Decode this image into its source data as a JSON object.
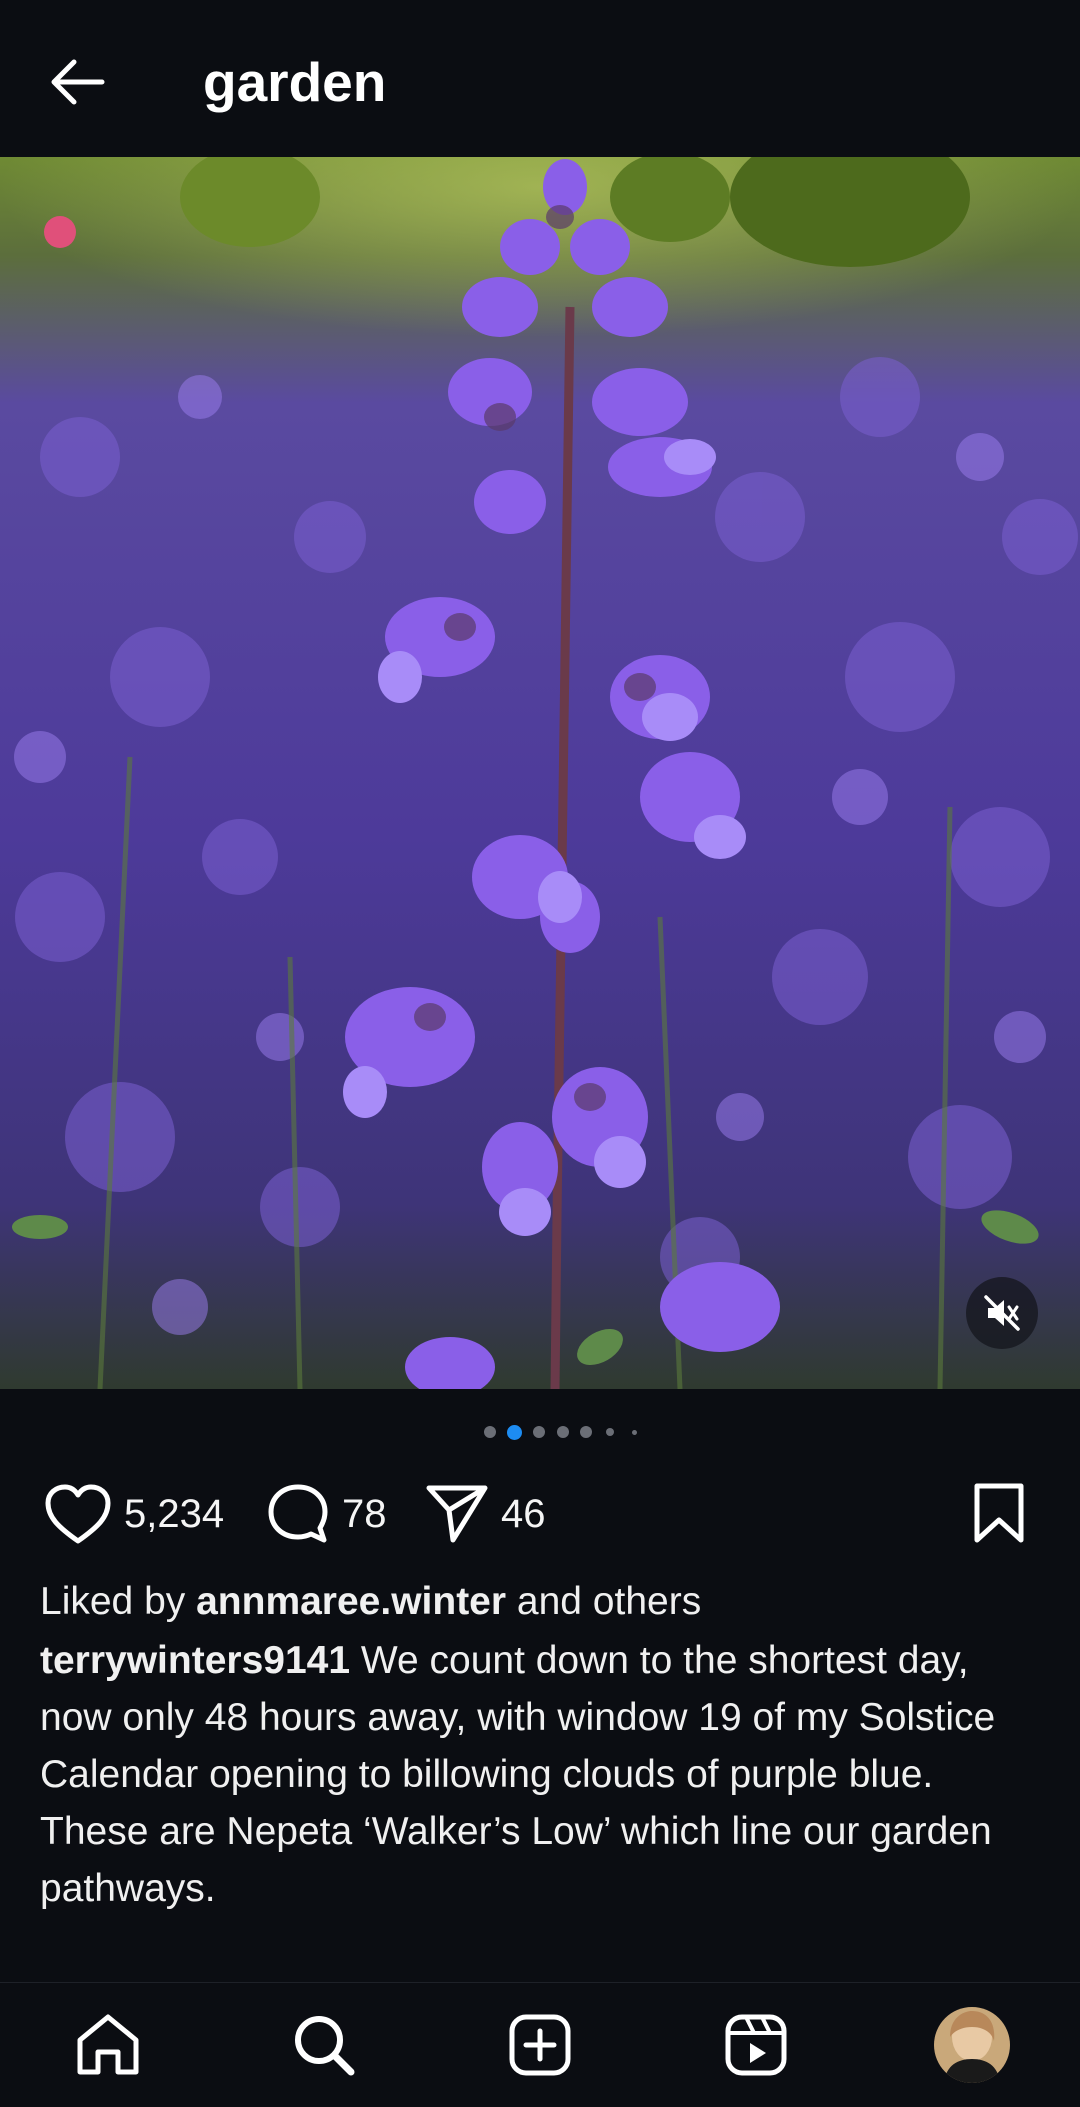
{
  "header": {
    "title": "garden",
    "back_icon": "arrow-left-icon"
  },
  "post": {
    "media_alt": "Nepeta flower spike in a field of purple-blue flowers",
    "carousel": {
      "total": 7,
      "active_index": 1
    },
    "actions": {
      "likes_count": "5,234",
      "comments_count": "78",
      "shares_count": "46"
    },
    "liked_by": {
      "prefix": "Liked by ",
      "user": "annmaree.winter",
      "suffix": " and others"
    },
    "caption": {
      "user": "terrywinters9141",
      "text": " We count down to the shortest day, now only 48 hours away, with window 19 of my Solstice Calendar opening to billowing clouds of purple blue.  These are Nepeta ‘Walker’s Low’ which line our garden pathways."
    }
  },
  "nav": {
    "items": [
      "home-icon",
      "search-icon",
      "create-icon",
      "reels-icon",
      "profile-avatar"
    ]
  },
  "colors": {
    "background": "#0b0d12",
    "accent_dot": "#1d8cf2",
    "text": "#f5f5f5"
  }
}
